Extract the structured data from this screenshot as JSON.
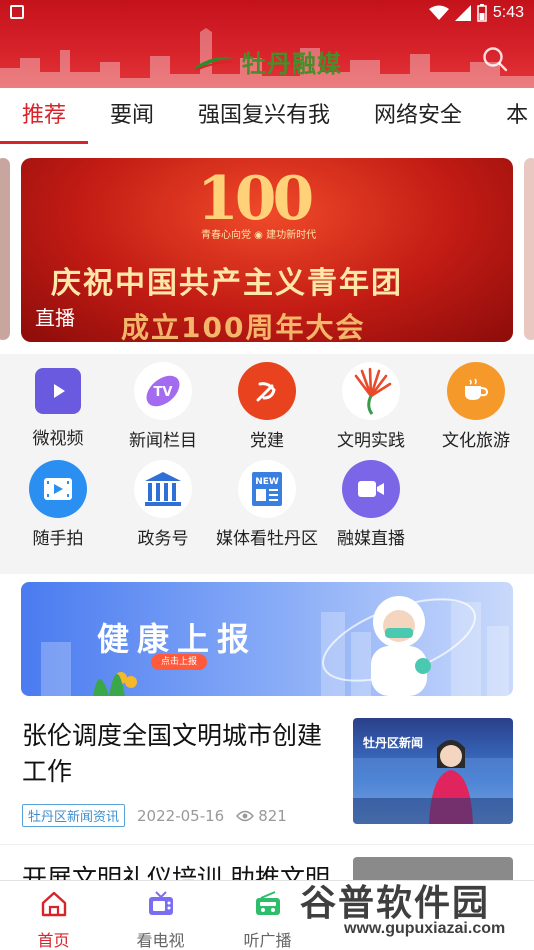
{
  "status": {
    "time": "5:43"
  },
  "header": {
    "brand": "牡丹融媒"
  },
  "tabs": [
    {
      "label": "推荐"
    },
    {
      "label": "要闻"
    },
    {
      "label": "强国复兴有我"
    },
    {
      "label": "网络安全"
    },
    {
      "label": "本"
    }
  ],
  "banner": {
    "number": "100",
    "subtitle": "青春心向党 ◉ 建功新时代",
    "line1": "庆祝中国共产主义青年团",
    "line2": "成立100周年大会",
    "tag": "直播"
  },
  "grid": [
    {
      "label": "微视频",
      "icon": "video-icon",
      "color": "#6a5ae0"
    },
    {
      "label": "新闻栏目",
      "icon": "tv-column-icon",
      "color": "#a46af0"
    },
    {
      "label": "党建",
      "icon": "party-emblem-icon",
      "color": "#e8421f"
    },
    {
      "label": "文明实践",
      "icon": "flower-icon",
      "color": "#e84a2a"
    },
    {
      "label": "文化旅游",
      "icon": "coffee-icon",
      "color": "#f59a2a"
    },
    {
      "label": "随手拍",
      "icon": "film-icon",
      "color": "#2a8ff0"
    },
    {
      "label": "政务号",
      "icon": "government-icon",
      "color": "#2f6fd6"
    },
    {
      "label": "媒体看牡丹区",
      "icon": "news-icon",
      "color": "#3a7fe0"
    },
    {
      "label": "融媒直播",
      "icon": "live-camera-icon",
      "color": "#7c66e8"
    }
  ],
  "health": {
    "title": "健康上报",
    "button": "点击上报"
  },
  "news": [
    {
      "title": "张伦调度全国文明城市创建工作",
      "tag": "牡丹区新闻资讯",
      "date": "2022-05-16",
      "views": "821",
      "thumb_caption": "牡丹区新闻"
    },
    {
      "title": "开展文明礼仪培训 助推文明"
    }
  ],
  "bottom_nav": [
    {
      "label": "首页",
      "icon": "home-icon"
    },
    {
      "label": "看电视",
      "icon": "tv-icon"
    },
    {
      "label": "听广播",
      "icon": "radio-icon"
    }
  ],
  "watermark": {
    "text": "谷普软件园",
    "url": "www.gupuxiazai.com"
  },
  "colors": {
    "accent": "#d8232b",
    "tag": "#3d8fcf"
  }
}
